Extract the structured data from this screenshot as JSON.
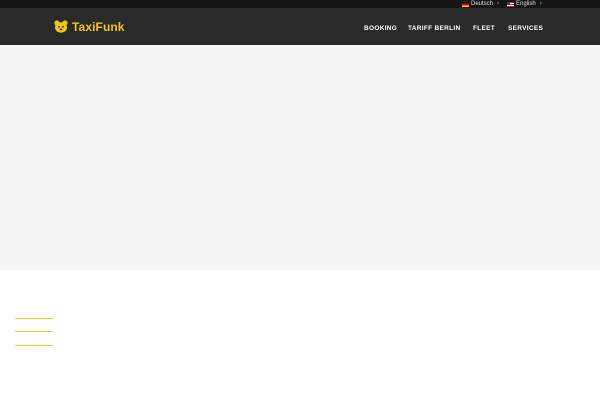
{
  "languages": [
    {
      "label": "Deutsch",
      "flag": "germany-flag-icon"
    },
    {
      "label": "English",
      "flag": "uk-flag-icon"
    }
  ],
  "chevron": "›",
  "brand": {
    "name": "TaxiFunk",
    "color": "#f5c518"
  },
  "nav": {
    "items": [
      {
        "label": "BOOKING"
      },
      {
        "label": "TARIFF BERLIN"
      },
      {
        "label": "FLEET"
      },
      {
        "label": "SERVICES"
      }
    ]
  },
  "colors": {
    "top_bar": "#151515",
    "header": "#2a2a2a",
    "hero": "#f5f5f5",
    "accent": "#f5c518"
  }
}
